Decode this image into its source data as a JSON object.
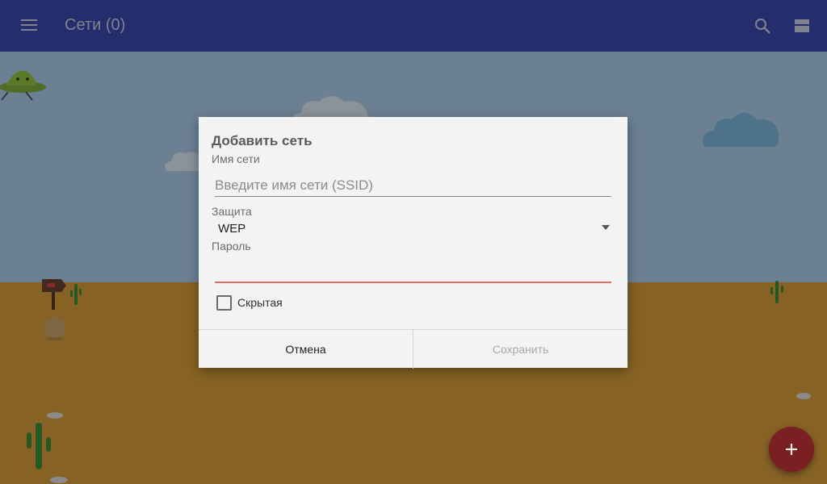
{
  "app_bar": {
    "title": "Сети (0)",
    "icons": [
      "menu-icon",
      "search-icon",
      "more-icon"
    ]
  },
  "dialog": {
    "title": "Добавить сеть",
    "ssid": {
      "label": "Имя сети",
      "placeholder": "Введите имя сети (SSID)",
      "value": ""
    },
    "security": {
      "label": "Защита",
      "value": "WEP"
    },
    "password": {
      "label": "Пароль",
      "value": ""
    },
    "hidden": {
      "label": "Скрытая",
      "checked": false
    },
    "cancel_label": "Отмена",
    "save_label": "Сохранить"
  },
  "fab": {
    "icon": "plus-icon"
  },
  "colors": {
    "app_bar": "#3949ab",
    "fab": "#b3262c",
    "error_underline": "#e53935",
    "sky": "#a8c8e4",
    "ground": "#d2993b"
  }
}
